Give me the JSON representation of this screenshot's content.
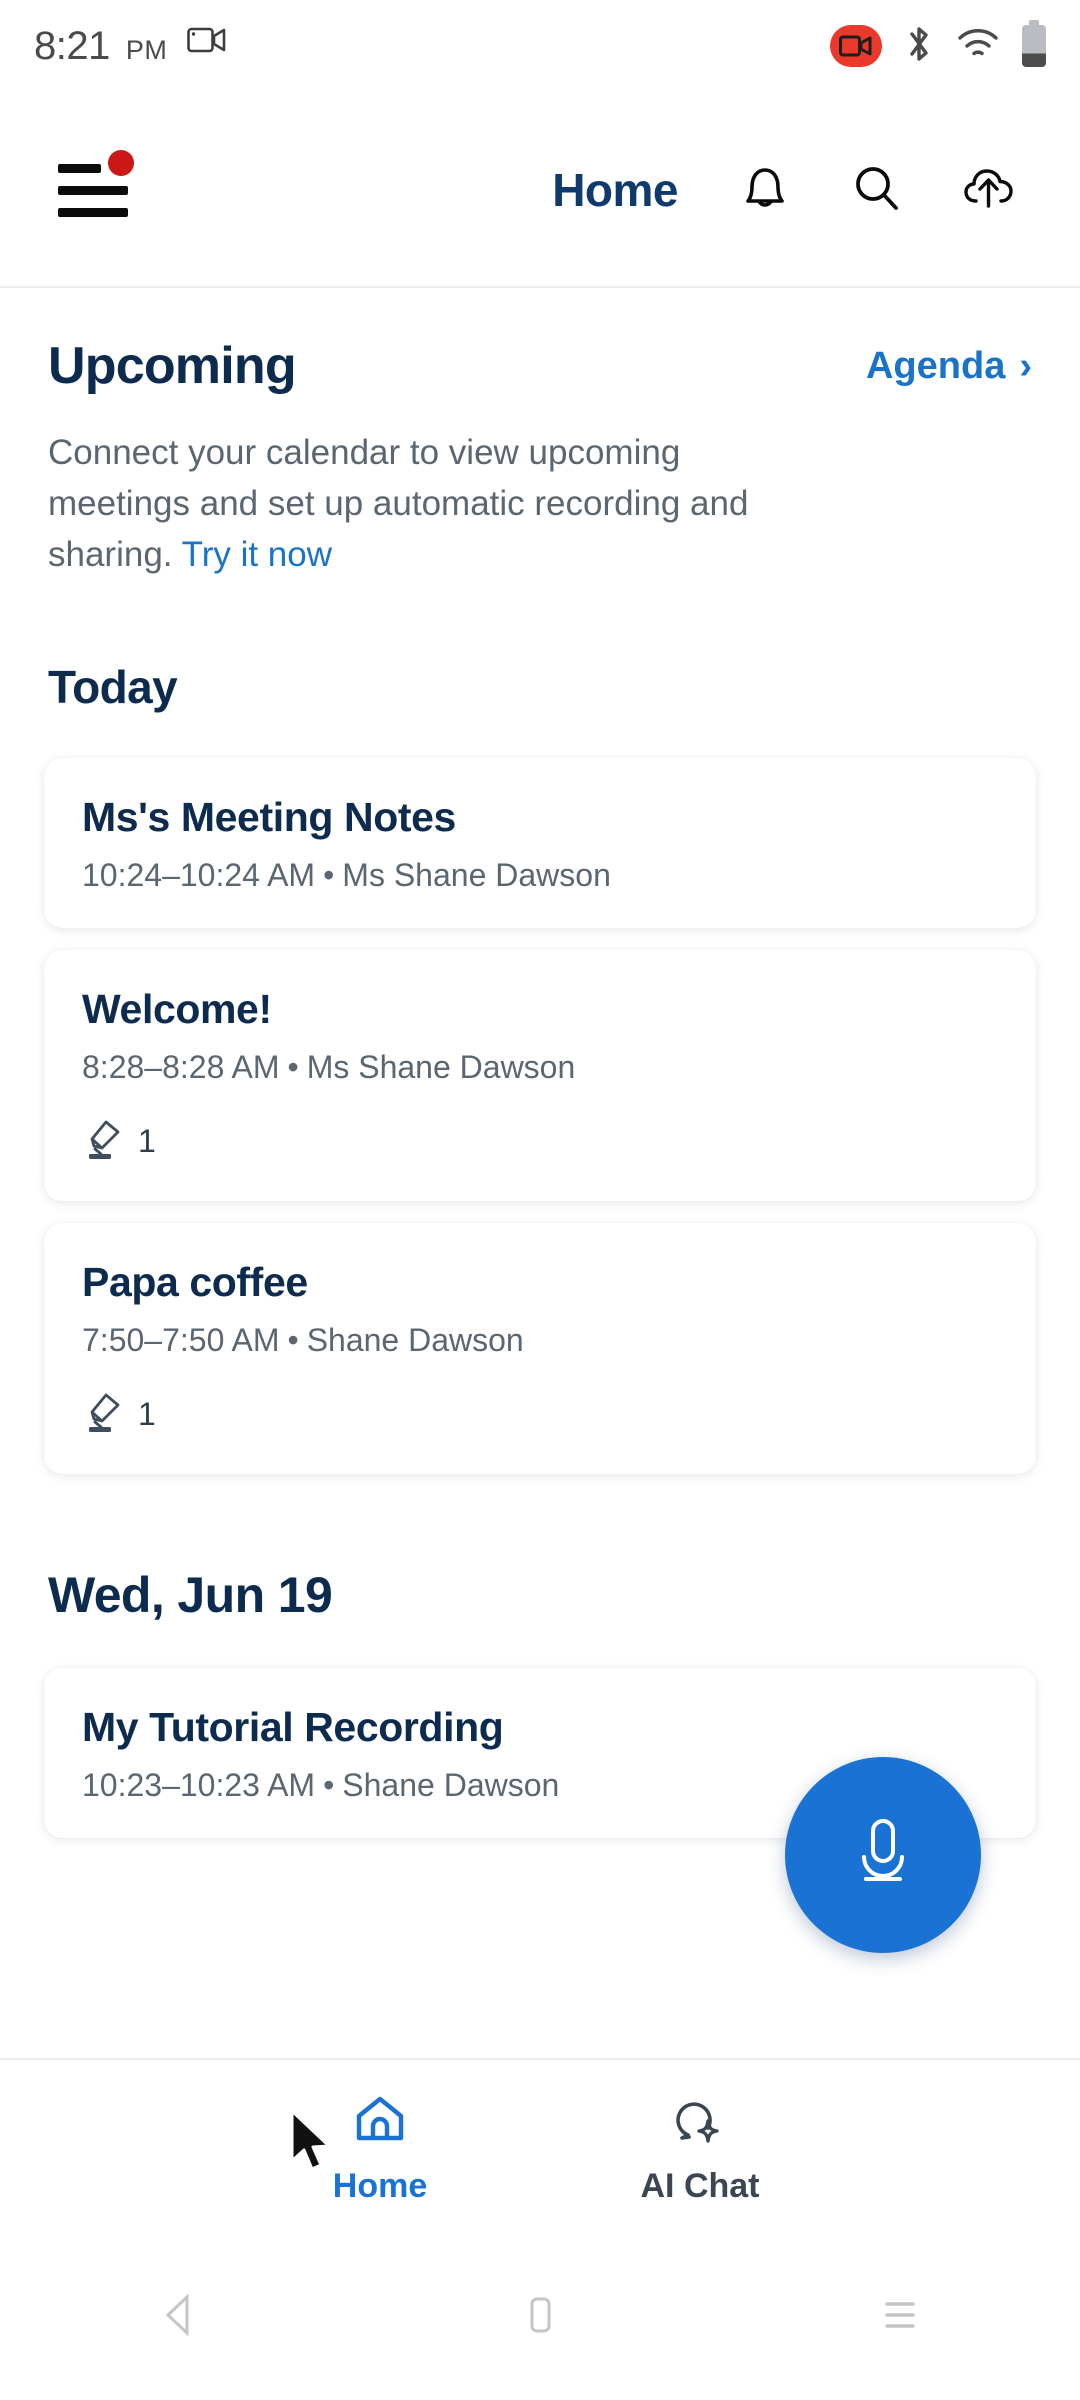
{
  "status_bar": {
    "time": "8:21",
    "ampm": "PM",
    "left_icon": "screen-record-icon",
    "right_icons": [
      "video-record-badge-icon",
      "bluetooth-icon",
      "wifi-icon",
      "battery-icon"
    ]
  },
  "header": {
    "menu_icon": "hamburger-menu-icon",
    "menu_badge": true,
    "title": "Home",
    "actions": [
      {
        "name": "notifications-bell-icon"
      },
      {
        "name": "search-icon"
      },
      {
        "name": "cloud-upload-icon"
      }
    ]
  },
  "upcoming": {
    "title": "Upcoming",
    "agenda_label": "Agenda",
    "agenda_chevron": "›",
    "description_prefix": "Connect your calendar to view upcoming meetings and set up automatic recording and sharing. ",
    "try_link": "Try it now"
  },
  "sections": [
    {
      "heading": "Today",
      "cards": [
        {
          "title": "Ms's Meeting Notes",
          "time": "10:24–10:24 AM",
          "separator": "•",
          "owner": "Ms Shane Dawson",
          "has_stats": false,
          "highlight_count": ""
        },
        {
          "title": "Welcome!",
          "time": "8:28–8:28 AM",
          "separator": "•",
          "owner": "Ms Shane Dawson",
          "has_stats": true,
          "highlight_count": "1"
        },
        {
          "title": "Papa coffee",
          "time": "7:50–7:50 AM",
          "separator": "•",
          "owner": "Shane Dawson",
          "has_stats": true,
          "highlight_count": "1"
        }
      ]
    },
    {
      "heading": "Wed, Jun 19",
      "cards": [
        {
          "title": "My Tutorial Recording",
          "time": "10:23–10:23 AM",
          "separator": "•",
          "owner": "Shane Dawson",
          "has_stats": false,
          "highlight_count": ""
        }
      ]
    }
  ],
  "fab": {
    "icon": "microphone-icon"
  },
  "bottom_nav": {
    "items": [
      {
        "label": "Home",
        "icon": "home-icon",
        "active": true
      },
      {
        "label": "AI Chat",
        "icon": "ai-chat-bubble-icon",
        "active": false
      }
    ]
  },
  "system_nav": {
    "back": "back-triangle-icon",
    "home": "home-square-icon",
    "recents": "recents-lines-icon"
  },
  "colors": {
    "accent_blue": "#1a73d4",
    "link_blue": "#1a73c8",
    "title_navy": "#0d2b4e",
    "header_navy": "#0f3a6e",
    "muted_gray": "#5c6671",
    "badge_red": "#cc1717",
    "record_red": "#e8392b"
  }
}
